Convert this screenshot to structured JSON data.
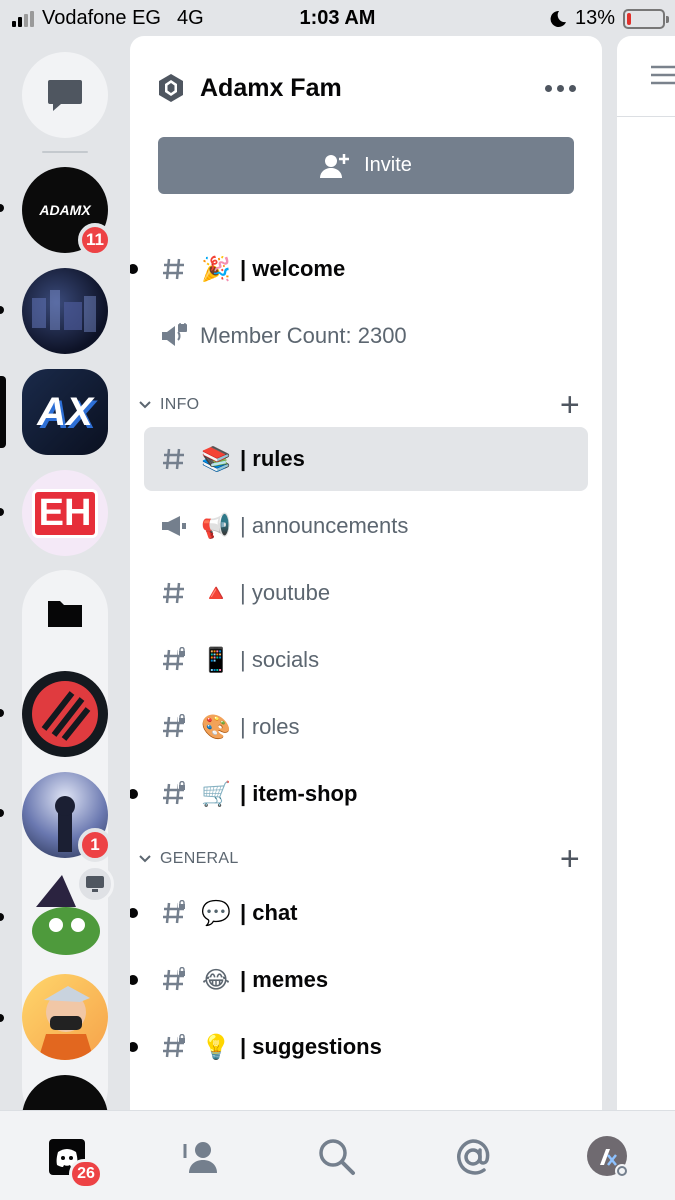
{
  "status_bar": {
    "carrier": "Vodafone EG",
    "network": "4G",
    "time": "1:03 AM",
    "battery": "13%",
    "battery_level": 0.13
  },
  "rail": {
    "guilds": [
      {
        "label": "ADAMX",
        "badge": "11"
      },
      {
        "label": ""
      },
      {
        "label": "AX"
      },
      {
        "label": "EH"
      },
      {
        "label": ""
      },
      {
        "label": "",
        "badge": "1"
      },
      {
        "label": ""
      },
      {
        "label": ""
      },
      {
        "label": ""
      }
    ]
  },
  "server": {
    "name": "Adamx Fam",
    "invite_label": "Invite"
  },
  "channels_top": [
    {
      "emoji": "🎉",
      "name": "| welcome",
      "type": "text",
      "unread": true
    },
    {
      "emoji": "",
      "name": "Member Count: 2300",
      "type": "voice-locked",
      "unread": false
    }
  ],
  "categories": [
    {
      "name": "INFO",
      "channels": [
        {
          "emoji": "📚",
          "name": "| rules",
          "type": "text",
          "active": true
        },
        {
          "emoji": "📢",
          "name": "| announcements",
          "type": "announce"
        },
        {
          "emoji": "🔺",
          "name": "| youtube",
          "type": "text"
        },
        {
          "emoji": "📱",
          "name": "| socials",
          "type": "text-locked"
        },
        {
          "emoji": "🎨",
          "name": "| roles",
          "type": "text-locked"
        },
        {
          "emoji": "🛒",
          "name": "| item-shop",
          "type": "text-locked",
          "unread": true
        }
      ]
    },
    {
      "name": "GENERAL",
      "channels": [
        {
          "emoji": "💬",
          "name": "| chat",
          "type": "text-locked",
          "unread": true
        },
        {
          "emoji": "😂",
          "name": "| memes",
          "type": "text-locked",
          "unread": true
        },
        {
          "emoji": "💡",
          "name": "| suggestions",
          "type": "text-locked",
          "unread": true
        }
      ]
    }
  ],
  "tabs": {
    "home_badge": "26",
    "items": [
      "home-tab",
      "friends-tab",
      "search-tab",
      "mentions-tab",
      "profile-tab"
    ]
  }
}
